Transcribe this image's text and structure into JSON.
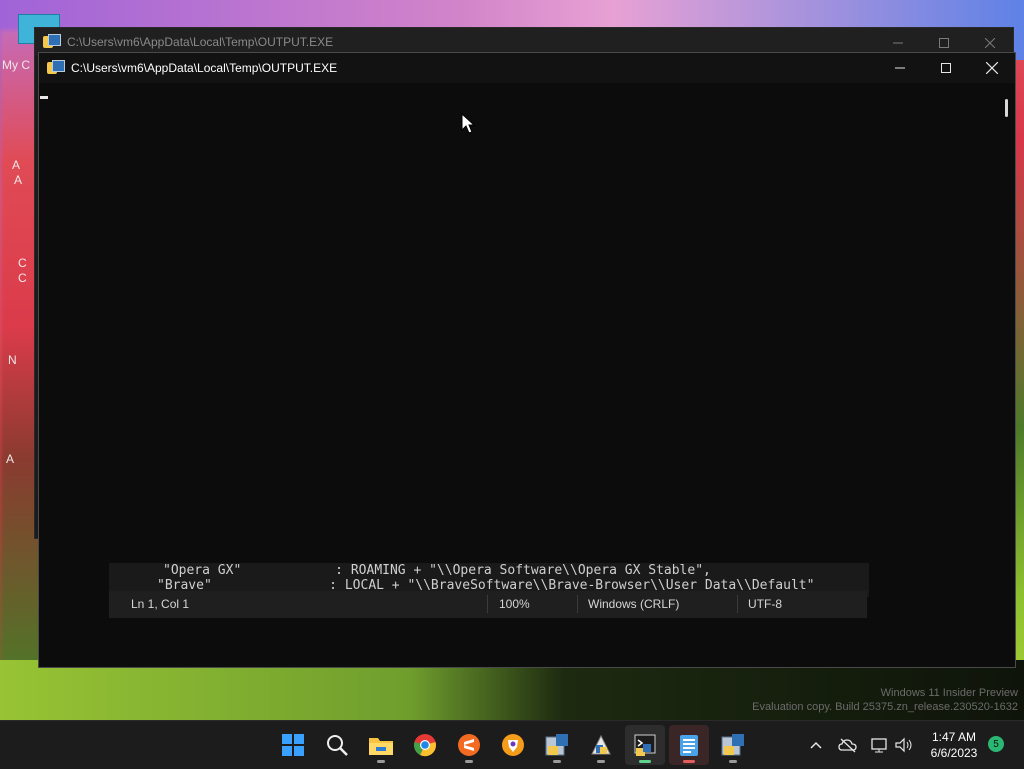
{
  "desktop": {
    "icon_label_partial": "My C",
    "side_letters": [
      "A",
      "A",
      "C",
      "C",
      "N",
      "A"
    ]
  },
  "back_window": {
    "title": "C:\\Users\\vm6\\AppData\\Local\\Temp\\OUTPUT.EXE"
  },
  "front_window": {
    "title": "C:\\Users\\vm6\\AppData\\Local\\Temp\\OUTPUT.EXE",
    "icon": "python-console-icon"
  },
  "notepad_behind": {
    "lines": [
      "\"Opera GX\"            : ROAMING + \"\\\\Opera Software\\\\Opera GX Stable\",",
      "\"Brave\"               : LOCAL + \"\\\\BraveSoftware\\\\Brave-Browser\\\\User Data\\\\Default\""
    ],
    "status": {
      "position": "Ln 1, Col 1",
      "zoom": "100%",
      "line_ending": "Windows (CRLF)",
      "encoding": "UTF-8"
    }
  },
  "watermark": {
    "line1": "Windows 11 Insider Preview",
    "line2": "Evaluation copy. Build 25375.zn_release.230520-1632"
  },
  "taskbar": {
    "apps": [
      "start-icon",
      "search-icon",
      "file-explorer-icon",
      "chrome-icon",
      "sublime-icon",
      "brave-icon",
      "python-installer-icon",
      "python-tool-icon",
      "python-console-icon",
      "notepad-icon",
      "python-setup-icon"
    ],
    "time": "1:47 AM",
    "date": "6/6/2023",
    "notification_count": "5"
  }
}
